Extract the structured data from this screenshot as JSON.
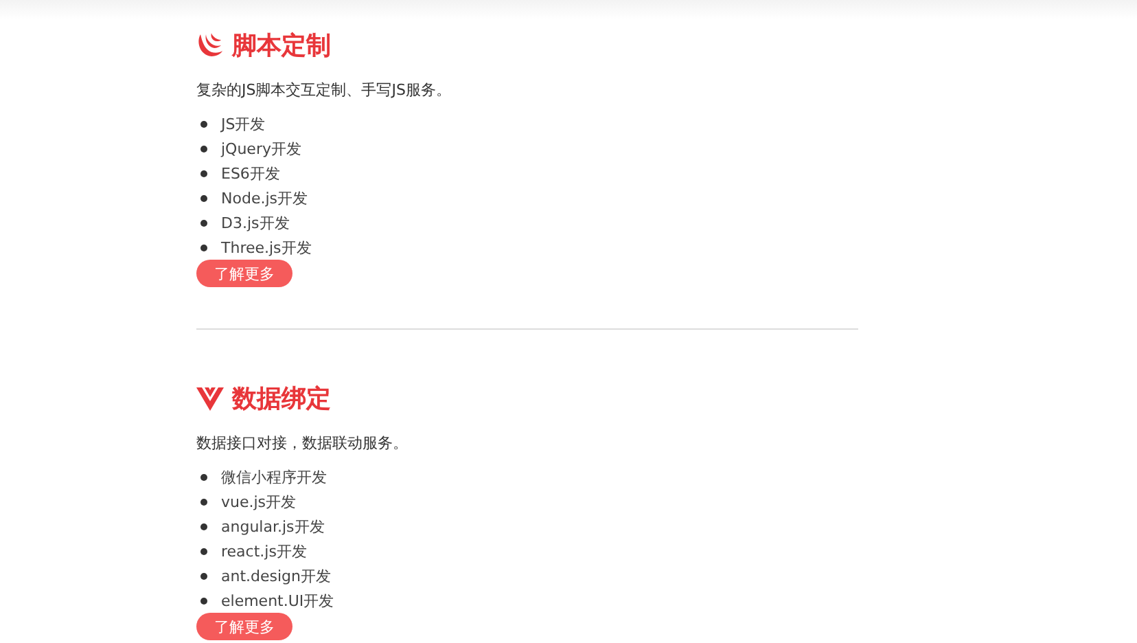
{
  "sections": [
    {
      "kind": "swirl",
      "title": "脚本定制",
      "description": "复杂的JS脚本交互定制、手写JS服务。",
      "items": [
        "JS开发",
        "jQuery开发",
        "ES6开发",
        "Node.js开发",
        "D3.js开发",
        "Three.js开发"
      ],
      "button": "了解更多"
    },
    {
      "kind": "vee",
      "title": "数据绑定",
      "description": "数据接口对接，数据联动服务。",
      "items": [
        "微信小程序开发",
        "vue.js开发",
        "angular.js开发",
        "react.js开发",
        "ant.design开发",
        "element.UI开发"
      ],
      "button": "了解更多"
    }
  ]
}
